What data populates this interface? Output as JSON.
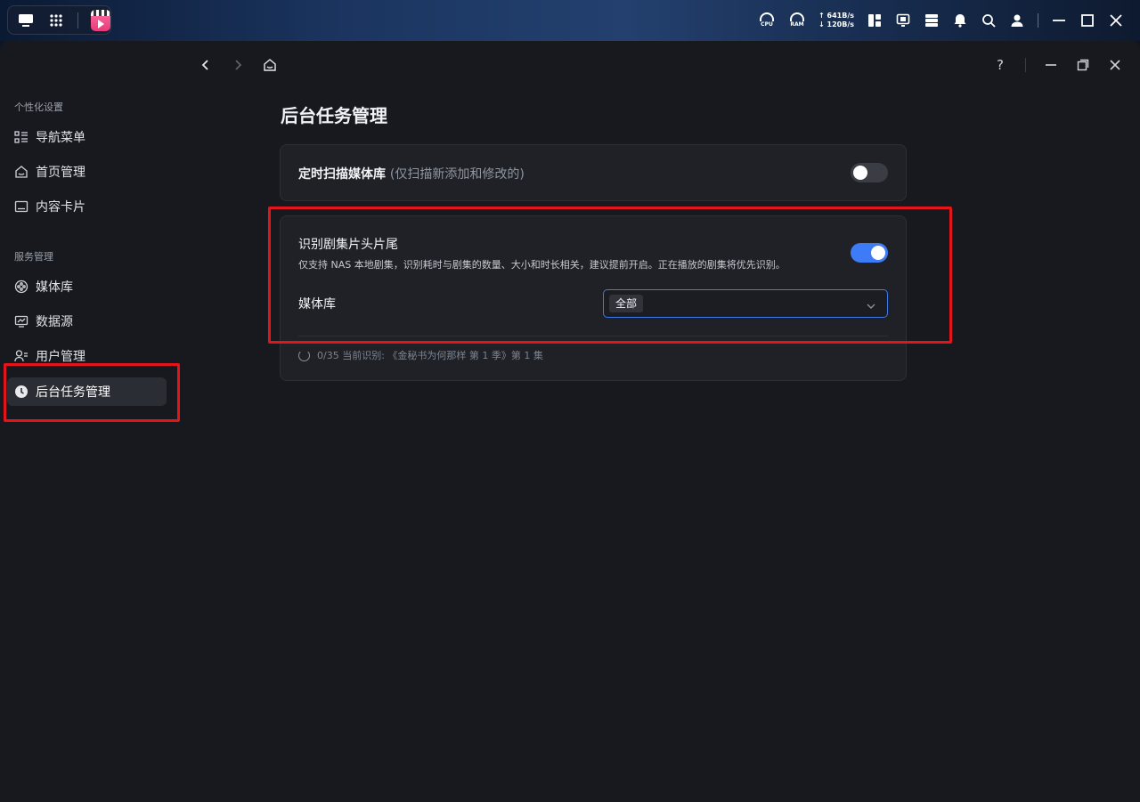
{
  "os_bar": {
    "cpu_label": "CPU",
    "ram_label": "RAM",
    "upload": "641B/s",
    "download": "120B/s"
  },
  "sidebar": {
    "section1_title": "个性化设置",
    "section1_items": [
      {
        "label": "导航菜单",
        "icon": "menu-grid-icon"
      },
      {
        "label": "首页管理",
        "icon": "home-icon"
      },
      {
        "label": "内容卡片",
        "icon": "card-icon"
      }
    ],
    "section2_title": "服务管理",
    "section2_items": [
      {
        "label": "媒体库",
        "icon": "media-icon"
      },
      {
        "label": "数据源",
        "icon": "datasource-icon"
      },
      {
        "label": "用户管理",
        "icon": "users-icon"
      },
      {
        "label": "后台任务管理",
        "icon": "clock-icon",
        "active": true
      }
    ]
  },
  "window_controls": {
    "help": "?"
  },
  "page": {
    "title": "后台任务管理",
    "scan": {
      "title": "定时扫描媒体库",
      "hint": "(仅扫描新添加和修改的)",
      "enabled": false
    },
    "intro_outro": {
      "title": "识别剧集片头片尾",
      "description": "仅支持 NAS 本地剧集，识别耗时与剧集的数量、大小和时长相关，建议提前开启。正在播放的剧集将优先识别。",
      "enabled": true,
      "library_label": "媒体库",
      "library_value": "全部",
      "progress_text": "0/35  当前识别: 《金秘书为何那样 第 1 季》第 1 集"
    }
  },
  "colors": {
    "accent": "#3e7cf7",
    "highlight": "#e3151a",
    "panel": "#1f2126",
    "background": "#17191e"
  }
}
